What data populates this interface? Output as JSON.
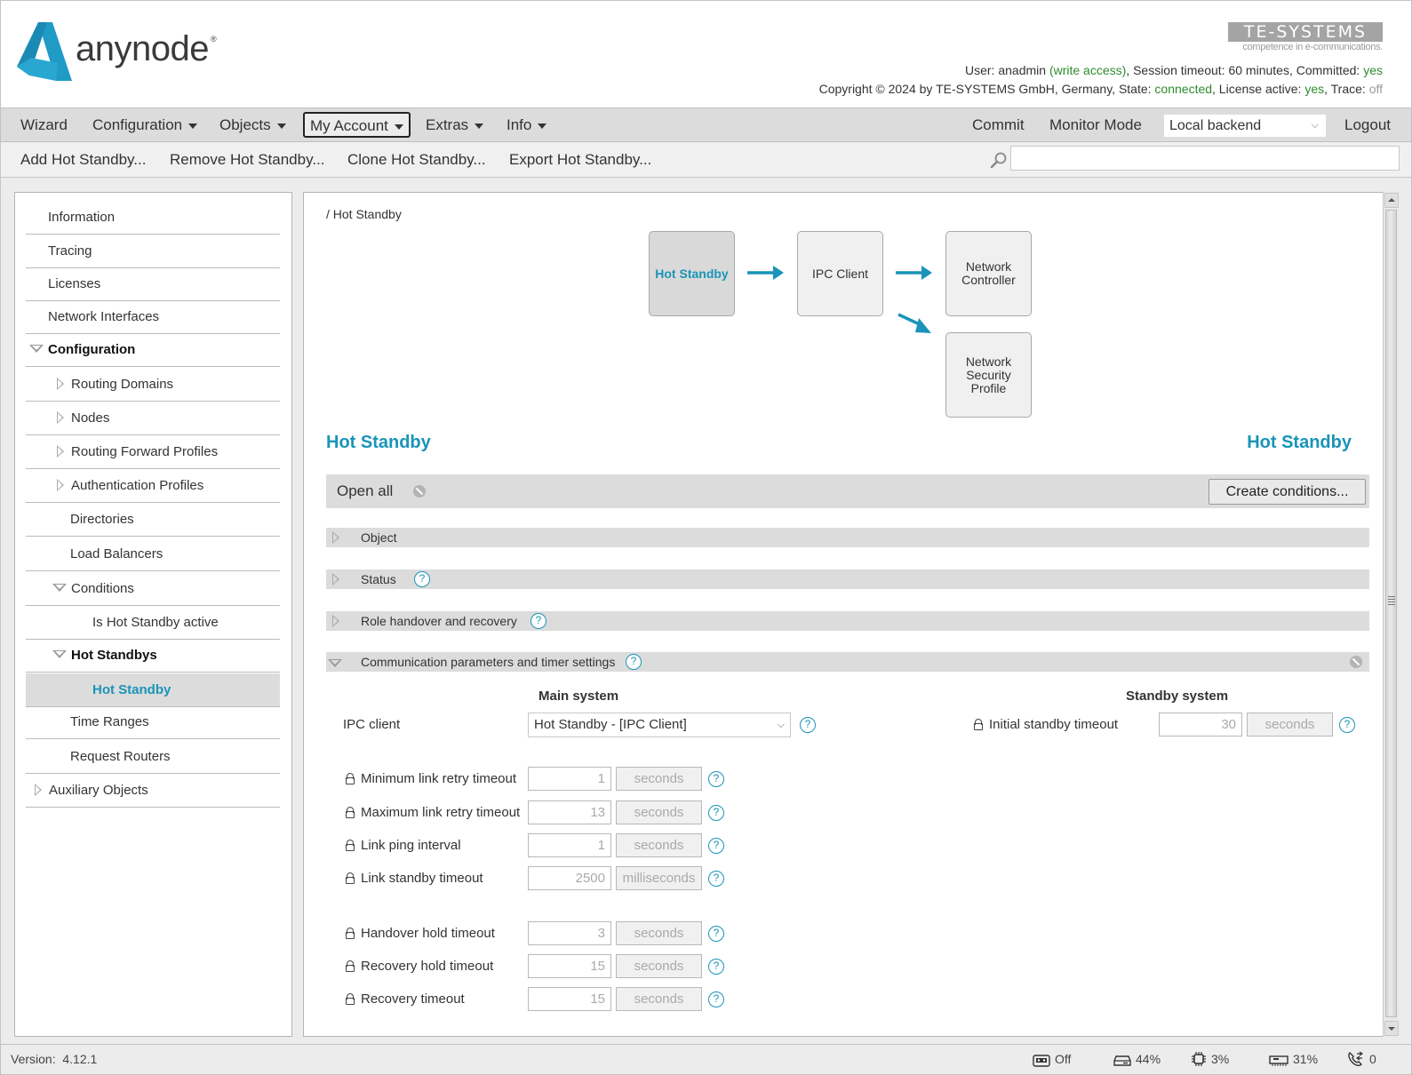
{
  "header": {
    "logo_text": "anynode",
    "logo_mark": "®",
    "vendor_logo": "TE-SYSTEMS",
    "vendor_tagline": "competence in e-communications.",
    "user_label": "User: ",
    "user": "anadmin",
    "access": "(write access)",
    "session_label": ", Session timeout: ",
    "session_timeout": "60 minutes",
    "committed_label": ", Committed: ",
    "committed": "yes",
    "copyright": "Copyright © 2024 by TE-SYSTEMS GmbH, Germany, State: ",
    "state": "connected",
    "license_label": ", License active: ",
    "license_active": "yes",
    "trace_label": ", Trace: ",
    "trace": "off",
    "colors": {
      "status_ok": "#2e8b2e",
      "accent": "#1a94b8"
    }
  },
  "menubar": {
    "items": [
      {
        "label": "Wizard"
      },
      {
        "label": "Configuration"
      },
      {
        "label": "Objects"
      },
      {
        "label": "My Account"
      },
      {
        "label": "Extras"
      },
      {
        "label": "Info"
      }
    ],
    "commit": "Commit",
    "monitor_mode": "Monitor Mode",
    "backend": "Local backend",
    "logout": "Logout"
  },
  "toolbar": {
    "add": "Add Hot Standby...",
    "remove": "Remove Hot Standby...",
    "clone": "Clone Hot Standby...",
    "export": "Export Hot Standby...",
    "search_value": ""
  },
  "sidebar": {
    "items": [
      {
        "label": "Information"
      },
      {
        "label": "Tracing"
      },
      {
        "label": "Licenses"
      },
      {
        "label": "Network Interfaces"
      },
      {
        "label": "Configuration"
      },
      {
        "label": "Routing Domains"
      },
      {
        "label": "Nodes"
      },
      {
        "label": "Routing Forward Profiles"
      },
      {
        "label": "Authentication Profiles"
      },
      {
        "label": "Directories"
      },
      {
        "label": "Load Balancers"
      },
      {
        "label": "Conditions"
      },
      {
        "label": "Is Hot Standby active"
      },
      {
        "label": "Hot Standbys"
      },
      {
        "label": "Hot Standby"
      },
      {
        "label": "Time Ranges"
      },
      {
        "label": "Request Routers"
      },
      {
        "label": "Auxiliary Objects"
      }
    ]
  },
  "content": {
    "breadcrumb": "/ Hot Standby",
    "diagram": {
      "current": "Hot Standby",
      "ipc_client": "IPC Client",
      "network_controller_1": "Network",
      "network_controller_2": "Controller",
      "nsp_1": "Network",
      "nsp_2": "Security",
      "nsp_3": "Profile"
    },
    "title_left": "Hot Standby",
    "title_right": "Hot Standby",
    "open_all": "Open all",
    "create_conditions": "Create conditions...",
    "sections": [
      {
        "label": "Object",
        "expanded": false
      },
      {
        "label": "Status",
        "expanded": false
      },
      {
        "label": "Role handover and recovery",
        "expanded": false
      },
      {
        "label": "Communication parameters and timer settings",
        "expanded": true
      }
    ],
    "main_system_heading": "Main system",
    "standby_system_heading": "Standby system",
    "ipc_client_label": "IPC client",
    "ipc_client_value": "Hot Standby - [IPC Client]",
    "main_fields": [
      {
        "label": "Minimum link retry timeout",
        "value": "1",
        "unit": "seconds"
      },
      {
        "label": "Maximum link retry timeout",
        "value": "13",
        "unit": "seconds"
      },
      {
        "label": "Link ping interval",
        "value": "1",
        "unit": "seconds"
      },
      {
        "label": "Link standby timeout",
        "value": "2500",
        "unit": "milliseconds"
      },
      {
        "label": "Handover hold timeout",
        "value": "3",
        "unit": "seconds"
      },
      {
        "label": "Recovery hold timeout",
        "value": "15",
        "unit": "seconds"
      },
      {
        "label": "Recovery timeout",
        "value": "15",
        "unit": "seconds"
      }
    ],
    "standby_fields": [
      {
        "label": "Initial standby timeout",
        "value": "30",
        "unit": "seconds"
      }
    ]
  },
  "statusbar": {
    "version_label": "Version:",
    "version": "4.12.1",
    "recording": "Off",
    "disk": "44%",
    "cpu": "3%",
    "memory": "31%",
    "calls": "0"
  }
}
